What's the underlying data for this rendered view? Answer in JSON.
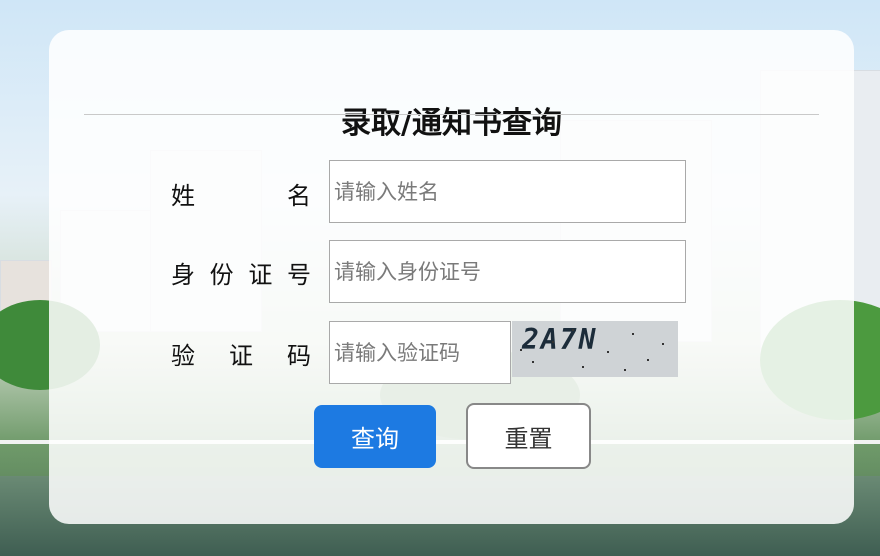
{
  "form": {
    "title": "录取/通知书查询",
    "name_label": [
      "姓",
      "名"
    ],
    "id_label": [
      "身",
      "份",
      "证",
      "号"
    ],
    "captcha_label": [
      "验",
      "证",
      "码"
    ],
    "name_placeholder": "请输入姓名",
    "id_placeholder": "请输入身份证号",
    "captcha_placeholder": "请输入验证码",
    "captcha_text": "2A7N",
    "query_button": "查询",
    "reset_button": "重置"
  },
  "colors": {
    "primary": "#1d7ae2",
    "card_background": "#ffffff"
  }
}
